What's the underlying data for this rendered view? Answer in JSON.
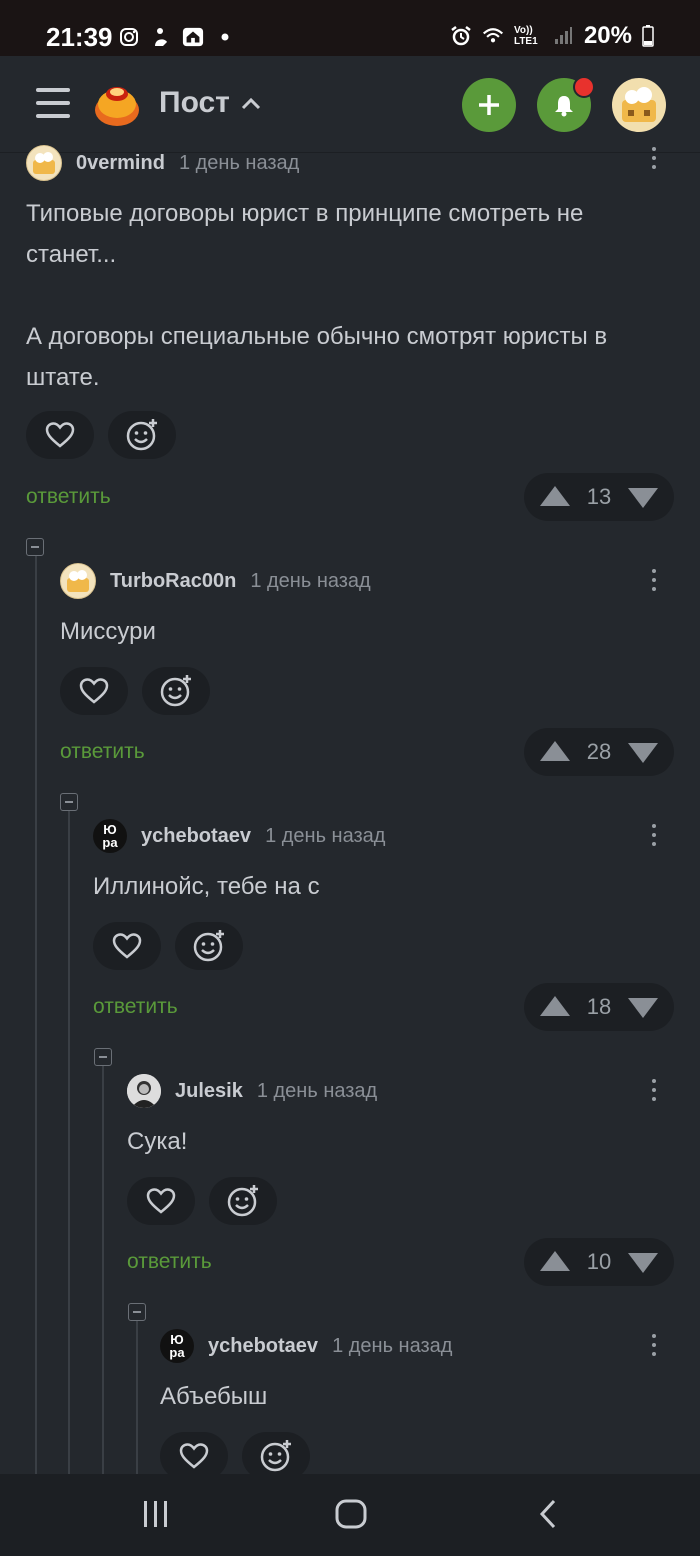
{
  "status": {
    "time": "21:39",
    "left_icons": [
      "instagram-icon",
      "notification-app-icon",
      "home-app-icon",
      "dot-icon"
    ],
    "right_icons": [
      "alarm-icon",
      "wifi-icon",
      "volte-icon",
      "signal-icon"
    ],
    "volte_label": "Vo)) LTE1",
    "battery": "20%"
  },
  "appbar": {
    "title": "Пост",
    "accent": "#5a9a3a",
    "badge_color": "#e8322d"
  },
  "comments": [
    {
      "user": "0vermind",
      "time": "1 день назад",
      "avatar": "cat-avatar",
      "text": "Типовые договоры юрист в принципе смотреть не станет...\n\nА договоры специальные обычно смотрят юристы в штате.",
      "reply_label": "ответить",
      "score": "13"
    },
    {
      "user": "TurboRac00n",
      "time": "1 день назад",
      "avatar": "cat-avatar",
      "text": "Миссури",
      "reply_label": "ответить",
      "score": "28"
    },
    {
      "user": "ychebotaev",
      "time": "1 день назад",
      "avatar": "yura-avatar",
      "avatar_text": [
        "Ю",
        "ра"
      ],
      "text": "Иллинойс, тебе на с",
      "reply_label": "ответить",
      "score": "18"
    },
    {
      "user": "Julesik",
      "time": "1 день назад",
      "avatar": "photo-avatar",
      "text": "Сука!",
      "reply_label": "ответить",
      "score": "10"
    },
    {
      "user": "ychebotaev",
      "time": "1 день назад",
      "avatar": "yura-avatar",
      "avatar_text": [
        "Ю",
        "ра"
      ],
      "text": "Абъебыш",
      "reply_label": "",
      "score": ""
    }
  ],
  "navbar": {
    "icons": [
      "recent-apps-icon",
      "home-icon",
      "back-icon"
    ]
  }
}
